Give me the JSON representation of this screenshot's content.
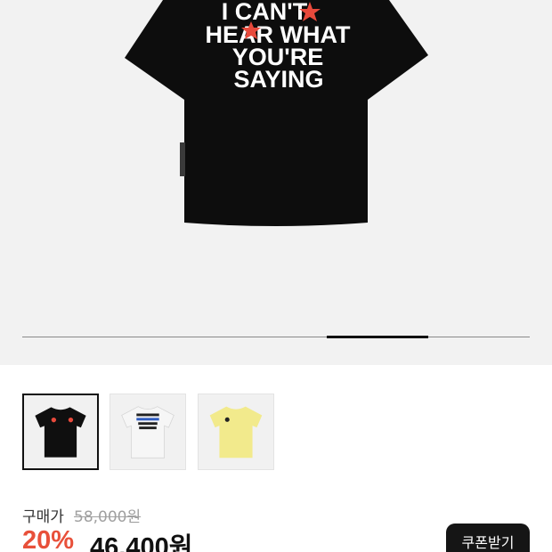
{
  "hero": {
    "shirt_color": "#0d0d0d",
    "print_lines": [
      "I CAN'T",
      "HEAR WHAT",
      "YOU'RE",
      "SAYING"
    ],
    "star_color": "#e84a3c",
    "image_index": 4,
    "image_count": 5
  },
  "thumbnails": [
    {
      "variant": "black",
      "color": "#0f0f0f",
      "selected": true
    },
    {
      "variant": "white",
      "color": "#f4f4f4",
      "selected": false
    },
    {
      "variant": "yellow",
      "color": "#f2ea8c",
      "selected": false
    }
  ],
  "price": {
    "label": "구매가",
    "original": "58,000원",
    "discount": "20%",
    "final": "46,400원",
    "discount_color": "#e8503a"
  },
  "coupon_button": {
    "label": "쿠폰받기"
  }
}
